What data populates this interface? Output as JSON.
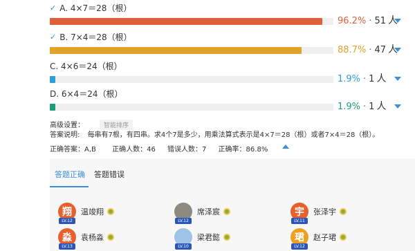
{
  "options": [
    {
      "label": "A. 4×7＝28（根）",
      "correct": true,
      "percent": "96.2%",
      "ratio": 0.962,
      "count": "51",
      "unit": "人",
      "bar_color": "#e0603a",
      "pct_color": "#e0603a"
    },
    {
      "label": "B. 7×4＝28（根）",
      "correct": true,
      "percent": "88.7%",
      "ratio": 0.887,
      "count": "47",
      "unit": "人",
      "bar_color": "#e2a229",
      "pct_color": "#e2a229"
    },
    {
      "label": "C. 4×6＝24（根）",
      "correct": false,
      "percent": "1.9%",
      "ratio": 0.019,
      "count": "1",
      "unit": "人",
      "bar_color": "#2e9ed6",
      "pct_color": "#2e9ed6"
    },
    {
      "label": "D. 6×4＝24（根）",
      "correct": false,
      "percent": "1.9%",
      "ratio": 0.019,
      "count": "1",
      "unit": "人",
      "bar_color": "#1e9c7a",
      "pct_color": "#1e9c7a"
    }
  ],
  "advanced": {
    "label": "高级设置：",
    "smart_sort": "智能排序"
  },
  "explanation": {
    "label": "答案说明:",
    "text": "每串有7根，有四串。求4个7是多少，用乘法算式表示是4×7＝28（根）或者7×4＝28（根）。"
  },
  "stats": {
    "correct_answer": "正确答案：A,B",
    "correct_count": "正确人数：46",
    "wrong_count": "错误人数：7",
    "accuracy": "正确率：86.8%"
  },
  "tabs": {
    "correct": "答题正确",
    "wrong": "答题错误"
  },
  "students": [
    {
      "name": "温竣翔",
      "char": "翔",
      "level": "LV.12",
      "color": "#e8602c"
    },
    {
      "name": "席泽宸",
      "char": "",
      "level": "LV.12",
      "color": "#8d8a80"
    },
    {
      "name": "张泽宇",
      "char": "宇",
      "level": "LV.11",
      "color": "#e8602c"
    },
    {
      "name": "袁杨淼",
      "char": "淼",
      "level": "LV.13",
      "color": "#e8602c"
    },
    {
      "name": "梁君懿",
      "char": "",
      "level": "LV.10",
      "color": "#9ec3e6"
    },
    {
      "name": "赵子珺",
      "char": "珺",
      "level": "LV.12",
      "color": "#f0a020"
    }
  ],
  "colors": {
    "accent": "#3a8fd8",
    "medal": "#7cb342"
  },
  "icons": {
    "check": "check-icon",
    "expand": "chevron-down-icon",
    "collapse": "caret-up-icon",
    "medal": "medal-icon"
  }
}
